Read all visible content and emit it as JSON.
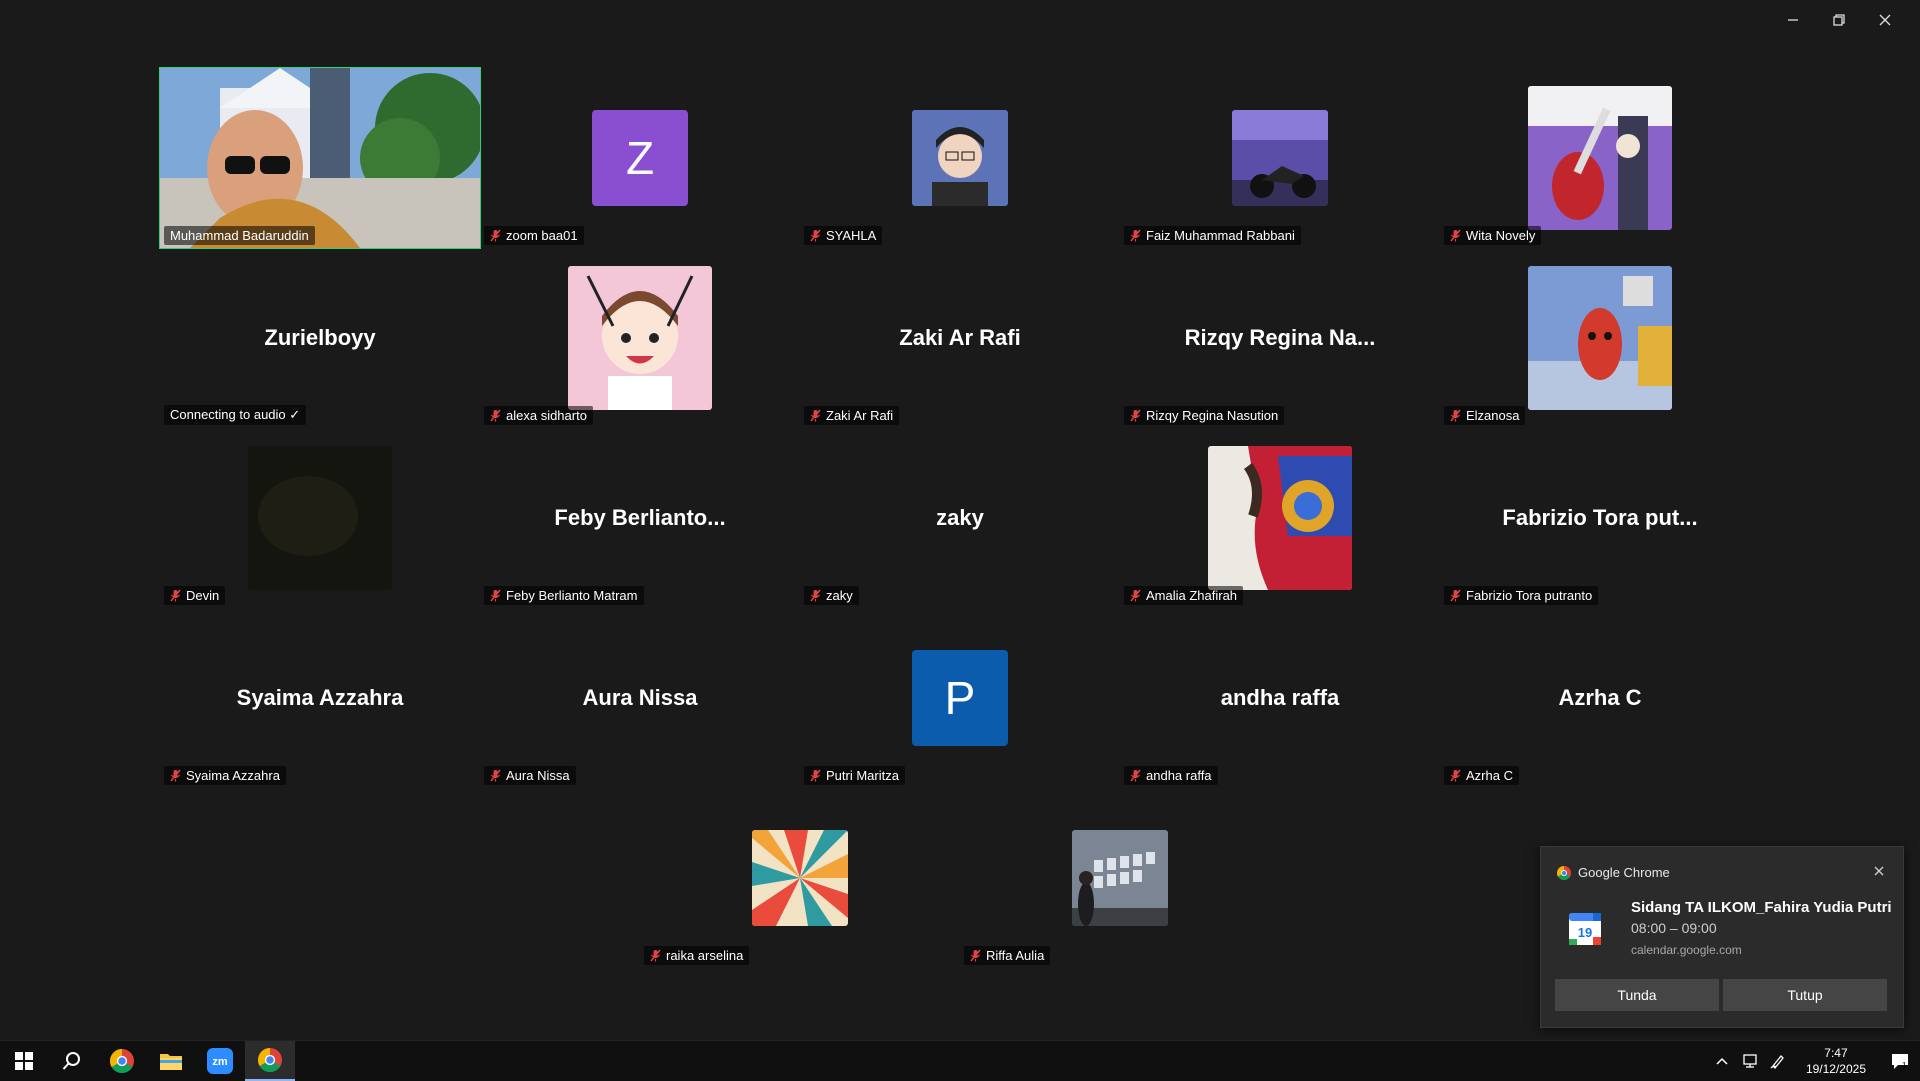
{
  "participants": [
    {
      "name": "Muhammad Badaruddin",
      "display": "photo",
      "photo": "man-glasses",
      "active": true,
      "muted": false
    },
    {
      "name": "zoom baa01",
      "display": "letter",
      "letter": "Z",
      "color": "#8a4fd1",
      "muted": true
    },
    {
      "name": "SYAHLA",
      "display": "photo-sm",
      "photo": "person-selfie",
      "muted": true
    },
    {
      "name": "Faiz Muhammad Rabbani",
      "display": "photo-sm",
      "photo": "motorbike",
      "muted": true
    },
    {
      "name": "Wita Novely",
      "display": "photo",
      "photo": "guitar",
      "muted": true
    },
    {
      "name": "Connecting to audio ✓",
      "display": "name",
      "bigname": "Zurielboyy",
      "muted": false
    },
    {
      "name": "alexa sidharto",
      "display": "photo",
      "photo": "anime",
      "muted": true
    },
    {
      "name": "Zaki Ar Rafi",
      "display": "name",
      "bigname": "Zaki Ar Rafi",
      "muted": true
    },
    {
      "name": "Rizqy Regina Nasution",
      "display": "name",
      "bigname": "Rizqy Regina Na...",
      "muted": true
    },
    {
      "name": "Elzanosa",
      "display": "photo",
      "photo": "cartoon-character",
      "muted": true
    },
    {
      "name": "Devin",
      "display": "photo",
      "photo": "dark",
      "muted": true
    },
    {
      "name": "Feby Berlianto Matram",
      "display": "name",
      "bigname": "Feby Berlianto...",
      "muted": true
    },
    {
      "name": "zaky",
      "display": "name",
      "bigname": "zaky",
      "muted": true
    },
    {
      "name": "Amalia Zhafirah",
      "display": "photo",
      "photo": "colorful-fabric",
      "muted": true
    },
    {
      "name": "Fabrizio Tora putranto",
      "display": "name",
      "bigname": "Fabrizio Tora put...",
      "muted": true
    },
    {
      "name": "Syaima Azzahra",
      "display": "name",
      "bigname": "Syaima Azzahra",
      "muted": true
    },
    {
      "name": "Aura Nissa",
      "display": "name",
      "bigname": "Aura Nissa",
      "muted": true
    },
    {
      "name": "Putri Maritza",
      "display": "letter",
      "letter": "P",
      "color": "#0b5cad",
      "muted": true
    },
    {
      "name": "andha raffa",
      "display": "name",
      "bigname": "andha raffa",
      "muted": true
    },
    {
      "name": "Azrha C",
      "display": "name",
      "bigname": "Azrha C",
      "muted": true
    },
    {
      "name": "raika arselina",
      "display": "photo-sm",
      "photo": "sunburst",
      "muted": true
    },
    {
      "name": "Riffa Aulia",
      "display": "photo-sm",
      "photo": "gallery-wall",
      "muted": true
    }
  ],
  "notification": {
    "app": "Google Chrome",
    "title": "Sidang TA ILKOM_Fahira Yudia Putri",
    "time": "08:00 – 09:00",
    "source": "calendar.google.com",
    "calendar_day": "19",
    "snooze_label": "Tunda",
    "close_label": "Tutup"
  },
  "taskbar": {
    "time": "7:47",
    "date": "19/12/2025",
    "notification_count": "1"
  },
  "colors": {
    "active_border": "#2bd37a",
    "mic_muted": "#e04646"
  }
}
